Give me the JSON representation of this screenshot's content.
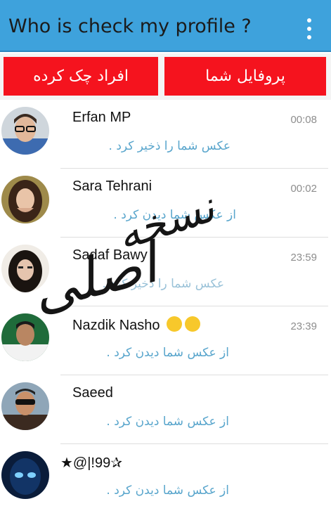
{
  "app": {
    "title": "Who is check my profile ?",
    "menu_icon": "more-vert-icon"
  },
  "tabs": [
    {
      "label": "افراد چک کرده"
    },
    {
      "label": "پروفایل شما"
    }
  ],
  "contacts": [
    {
      "name": "Erfan MP",
      "time": "00:08",
      "message": "عکس شما را ذخیر کرد ."
    },
    {
      "name": "Sara Tehrani",
      "time": "00:02",
      "message": "از عکس شما دیدن کرد ."
    },
    {
      "name": "Sadaf Bawy",
      "time": "23:59",
      "message": "عکس شما را ذخیر کرد ."
    },
    {
      "name": "Nazdik Nasho",
      "time": "23:39",
      "message": "از عکس شما دیدن کرد ."
    },
    {
      "name": "Saeed",
      "time": "",
      "message": "از عکس شما دیدن کرد ."
    },
    {
      "name": "★@|!99✰",
      "time": "",
      "message": "از عکس شما دیدن کرد ."
    }
  ],
  "watermark": {
    "line1": "نسخه",
    "line2": "اصلی"
  },
  "colors": {
    "appbar": "#3ea2dc",
    "tab": "#f5131e",
    "message": "#58a5cc"
  }
}
